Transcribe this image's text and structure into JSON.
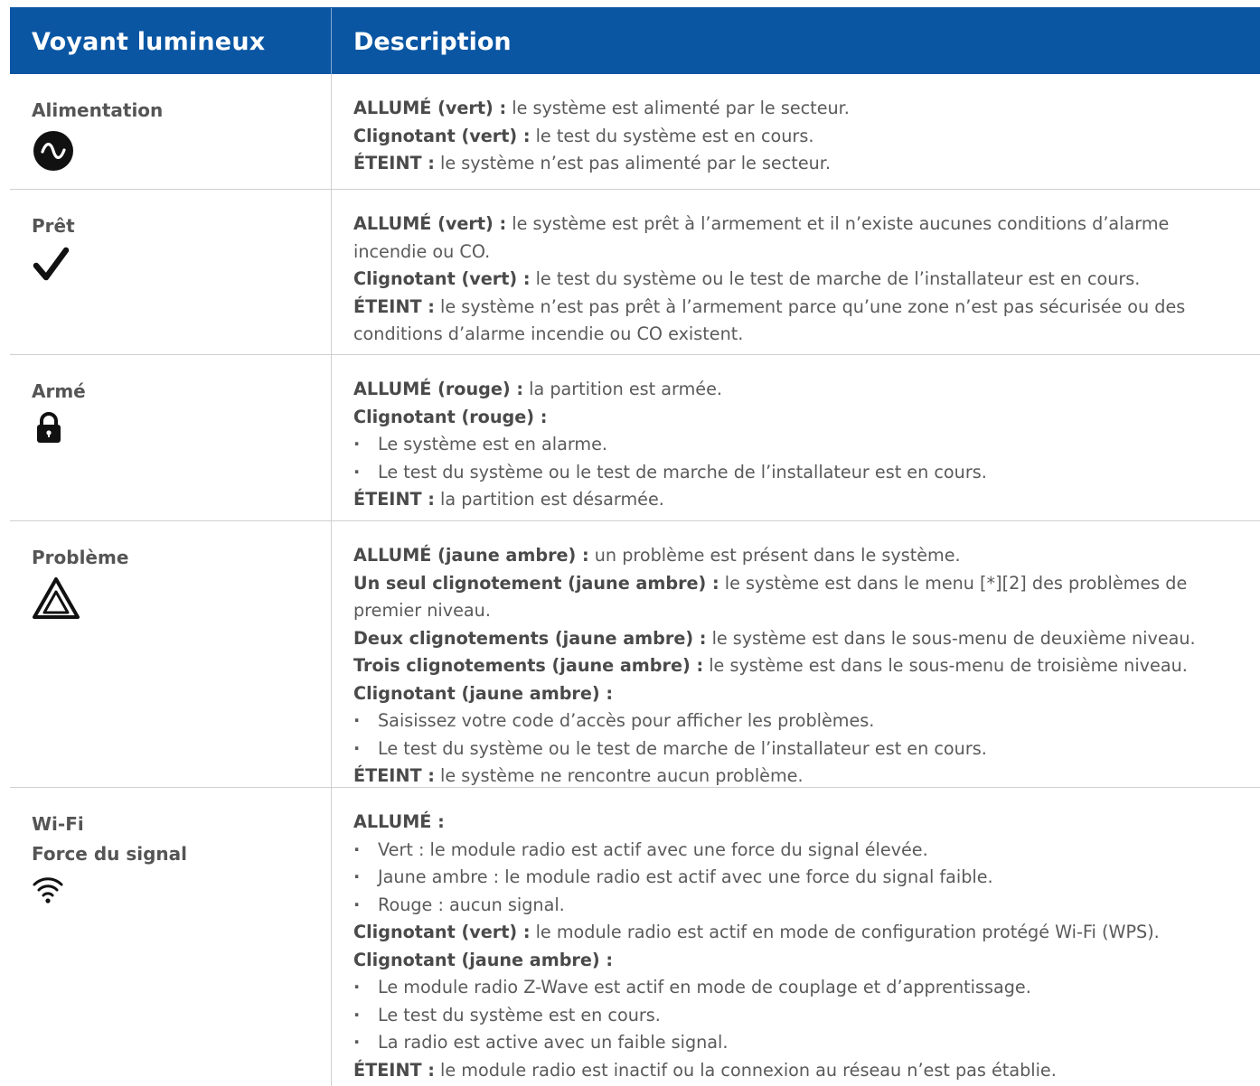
{
  "header": {
    "col1": "Voyant lumineux",
    "col2": "Description"
  },
  "rows": [
    {
      "label": "Alimentation",
      "icon": "power-ac-icon",
      "lines": [
        {
          "b": "ALLUMÉ (vert) :",
          "t": " le système est alimenté par le secteur."
        },
        {
          "b": "Clignotant (vert) :",
          "t": " le test du système est en cours."
        },
        {
          "b": "ÉTEINT :",
          "t": " le système n’est pas alimenté par le secteur."
        }
      ]
    },
    {
      "label": "Prêt",
      "icon": "checkmark-icon",
      "lines": [
        {
          "b": "ALLUMÉ (vert) :",
          "t": " le système est prêt à l’armement et il n’existe aucunes conditions d’alarme incendie ou CO."
        },
        {
          "b": "Clignotant (vert) :",
          "t": " le test du système ou le test de marche de l’installateur est en cours."
        },
        {
          "b": "ÉTEINT :",
          "t": " le système n’est pas prêt à l’armement parce qu’une zone n’est pas sécurisée ou des conditions d’alarme incendie ou CO existent."
        }
      ]
    },
    {
      "label": "Armé",
      "icon": "lock-icon",
      "lines": [
        {
          "b": "ALLUMÉ (rouge) :",
          "t": " la partition est armée."
        },
        {
          "b": "Clignotant (rouge) :",
          "t": ""
        },
        {
          "bullet": "Le système est en alarme."
        },
        {
          "bullet": "Le test du système ou le test de marche de l’installateur est en cours."
        },
        {
          "b": "ÉTEINT :",
          "t": " la partition est désarmée."
        }
      ]
    },
    {
      "label": "Problème",
      "icon": "warning-triangle-icon",
      "lines": [
        {
          "b": "ALLUMÉ (jaune ambre) :",
          "t": " un problème est présent dans le système."
        },
        {
          "b": "Un seul clignotement (jaune ambre) :",
          "t": " le système est dans le menu [*][2] des problèmes de premier niveau."
        },
        {
          "b": "Deux clignotements (jaune ambre) :",
          "t": " le système est dans le sous-menu de deuxième niveau."
        },
        {
          "b": "Trois clignotements (jaune ambre) :",
          "t": " le système est dans le sous-menu de troisième niveau."
        },
        {
          "b": "Clignotant (jaune ambre) :",
          "t": ""
        },
        {
          "bullet": "Saisissez votre code d’accès pour afficher les problèmes."
        },
        {
          "bullet": "Le test du système ou le test de marche de l’installateur est en cours."
        },
        {
          "b": "ÉTEINT :",
          "t": " le système ne rencontre aucun problème."
        }
      ]
    },
    {
      "label": "Wi-Fi",
      "label2": "Force du signal",
      "icon": "wifi-icon",
      "lines": [
        {
          "b": "ALLUMÉ :",
          "t": ""
        },
        {
          "bullet": "Vert : le module radio est actif avec une force du signal élevée."
        },
        {
          "bullet": "Jaune ambre : le module radio est actif avec une force du signal faible."
        },
        {
          "bullet": "Rouge : aucun signal."
        },
        {
          "b": "Clignotant (vert) :",
          "t": " le module radio est actif en mode de configuration protégé Wi-Fi (WPS)."
        },
        {
          "b": "Clignotant (jaune ambre) :",
          "t": ""
        },
        {
          "bullet": "Le module radio Z-Wave est actif en mode de couplage et d’apprentissage."
        },
        {
          "bullet": "Le test du système est en cours."
        },
        {
          "bullet": "La radio est active avec un faible signal."
        },
        {
          "b": "ÉTEINT :",
          "t": " le module radio est inactif ou la connexion au réseau n’est pas établie."
        }
      ]
    }
  ]
}
